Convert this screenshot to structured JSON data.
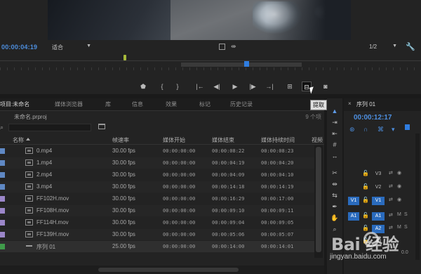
{
  "monitor": {
    "timecode": "00:00:04:19",
    "fit_label": "适合",
    "resolution_label": "1/2"
  },
  "transport": {
    "buttons": [
      "marker-icon",
      "mark-in-icon",
      "mark-out-icon",
      "go-to-in-icon",
      "step-back-icon",
      "play-icon",
      "step-forward-icon",
      "go-to-out-icon",
      "lift-icon",
      "extract-icon",
      "export-frame-icon"
    ],
    "tooltip": "提取"
  },
  "project": {
    "tabs": [
      "项目:未命名",
      "媒体浏览器",
      "库",
      "信息",
      "效果",
      "标记",
      "历史记录"
    ],
    "project_file": "未命名.prproj",
    "item_count": "9 个项",
    "columns": [
      "名称",
      "帧速率",
      "媒体开始",
      "媒体结束",
      "媒体持续时间",
      "视频"
    ],
    "rows": [
      {
        "name": "0.mp4",
        "fps": "30.00 fps",
        "start": "00:00:00:00",
        "end": "00:00:08:22",
        "duration": "00:00:08:23",
        "color": "#5f88c4"
      },
      {
        "name": "1.mp4",
        "fps": "30.00 fps",
        "start": "00:00:00:00",
        "end": "00:00:04:19",
        "duration": "00:00:04:20",
        "color": "#5f88c4"
      },
      {
        "name": "2.mp4",
        "fps": "30.00 fps",
        "start": "00:00:00:00",
        "end": "00:00:04:09",
        "duration": "00:00:04:10",
        "color": "#5f88c4"
      },
      {
        "name": "3.mp4",
        "fps": "30.00 fps",
        "start": "00:00:00:00",
        "end": "00:00:14:18",
        "duration": "00:00:14:19",
        "color": "#5f88c4"
      },
      {
        "name": "FF102H.mov",
        "fps": "30.00 fps",
        "start": "00:00:00:00",
        "end": "00:00:16:29",
        "duration": "00:00:17:00",
        "color": "#9b86c9"
      },
      {
        "name": "FF108H.mov",
        "fps": "30.00 fps",
        "start": "00:00:00:00",
        "end": "00:00:09:10",
        "duration": "00:00:09:11",
        "color": "#9b86c9"
      },
      {
        "name": "FF114H.mov",
        "fps": "30.00 fps",
        "start": "00:00:00:00",
        "end": "00:00:09:04",
        "duration": "00:00:09:05",
        "color": "#9b86c9"
      },
      {
        "name": "FF139H.mov",
        "fps": "30.00 fps",
        "start": "00:00:00:00",
        "end": "00:00:05:06",
        "duration": "00:00:05:07",
        "color": "#9b86c9"
      },
      {
        "name": "序列 01",
        "fps": "25.00 fps",
        "start": "00:00:00:00",
        "end": "00:00:14:00",
        "duration": "00:00:14:01",
        "color": "#3f9b4a"
      }
    ]
  },
  "timeline": {
    "tab": "序列 01",
    "timecode": "00:00:12:17",
    "tracks": [
      {
        "source": "",
        "name": "V3",
        "highlight": false
      },
      {
        "source": "",
        "name": "V2",
        "highlight": false
      },
      {
        "source": "V1",
        "name": "V1",
        "highlight": true
      },
      {
        "source": "A1",
        "name": "A1",
        "highlight": true
      },
      {
        "source": "",
        "name": "A2",
        "highlight": true
      },
      {
        "source": "",
        "name": "A3",
        "highlight": false
      }
    ],
    "track_flags": [
      "M",
      "S"
    ],
    "master_value": "0.0"
  },
  "watermark": {
    "logo": "Bai 经验",
    "url": "jingyan.baidu.com"
  }
}
